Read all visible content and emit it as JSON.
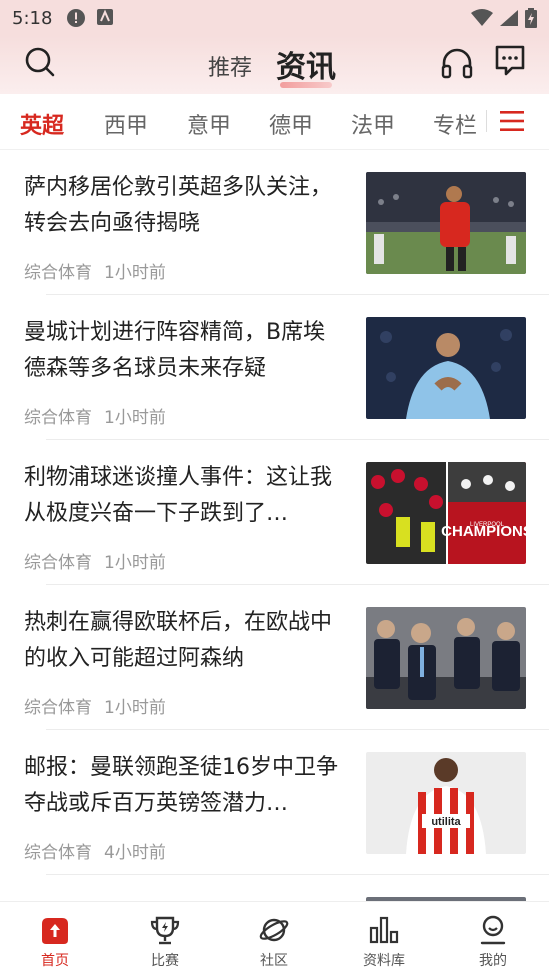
{
  "status_bar": {
    "time": "5:18"
  },
  "header": {
    "tabs": [
      {
        "label": "推荐",
        "active": false
      },
      {
        "label": "资讯",
        "active": true
      }
    ]
  },
  "leagues": [
    "英超",
    "西甲",
    "意甲",
    "德甲",
    "法甲",
    "专栏"
  ],
  "news": [
    {
      "title": "萨内移居伦敦引英超多队关注，转会去向亟待揭晓",
      "source": "综合体育",
      "time": "1小时前"
    },
    {
      "title": "曼城计划进行阵容精简，B席埃德森等多名球员未来存疑",
      "source": "综合体育",
      "time": "1小时前"
    },
    {
      "title": "利物浦球迷谈撞人事件：这让我从极度兴奋一下子跌到了…",
      "source": "综合体育",
      "time": "1小时前",
      "image_text": "CHAMPIONS",
      "image_subtext": "LIVERPOOL"
    },
    {
      "title": "热刺在赢得欧联杯后，在欧战中的收入可能超过阿森纳",
      "source": "综合体育",
      "time": "1小时前"
    },
    {
      "title": "邮报：曼联领跑圣徒16岁中卫争夺战或斥百万英镑签潜力…",
      "source": "综合体育",
      "time": "4小时前",
      "image_text": "utilita"
    }
  ],
  "tab_bar": [
    {
      "label": "首页",
      "icon": "home-icon",
      "active": true
    },
    {
      "label": "比赛",
      "icon": "trophy-icon",
      "active": false
    },
    {
      "label": "社区",
      "icon": "planet-icon",
      "active": false
    },
    {
      "label": "资料库",
      "icon": "bar-chart-icon",
      "active": false
    },
    {
      "label": "我的",
      "icon": "user-icon",
      "active": false
    }
  ],
  "colors": {
    "accent": "#d7281f",
    "header_bg": "#f6dedd"
  }
}
